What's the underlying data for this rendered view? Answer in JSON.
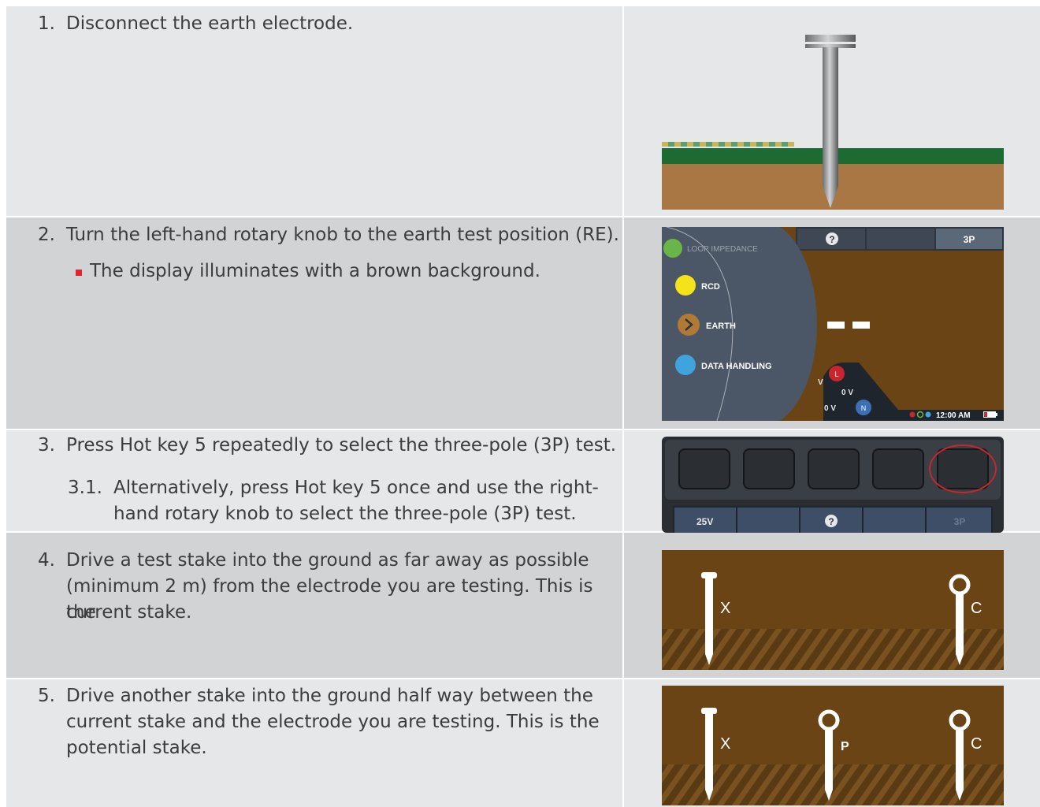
{
  "steps": [
    {
      "num": "1.",
      "text": "Disconnect the earth electrode."
    },
    {
      "num": "2.",
      "text": "Turn the left-hand rotary knob to the earth test position (RE).",
      "bullet": "The display illuminates with a brown background."
    },
    {
      "num": "3.",
      "text": "Press Hot key 5 repeatedly to select the three-pole (3P) test.",
      "sub_num": "3.1.",
      "sub_line1": "Alternatively, press Hot key 5 once and use the right-",
      "sub_line2": "hand rotary knob to select the three-pole (3P) test."
    },
    {
      "num": "4.",
      "line1": "Drive a test stake into the ground as far away as possible",
      "line2": "(minimum 2 m) from the electrode you are testing. This is the",
      "line3": "current stake."
    },
    {
      "num": "5.",
      "line1": "Drive another stake into the ground half way between the",
      "line2": "current stake and the electrode you are testing. This is the",
      "line3": "potential stake."
    }
  ],
  "display": {
    "menu": [
      "LOOP IMPEDANCE",
      "RCD",
      "EARTH",
      "DATA HANDLING"
    ],
    "help": "?",
    "mode": "3P",
    "L": "L",
    "N": "N",
    "volt1": "0 V",
    "volt2": "0 V",
    "volt3": "V",
    "time": "12:00 AM"
  },
  "hotkeys": {
    "labels": [
      "25V",
      "?",
      "3P"
    ]
  },
  "stakes": {
    "x": "X",
    "p": "P",
    "c": "C"
  },
  "colors": {
    "accent_red": "#e5232b",
    "brown_bg": "#6b4415",
    "grass": "#1d6b32",
    "soil": "#a87744"
  }
}
